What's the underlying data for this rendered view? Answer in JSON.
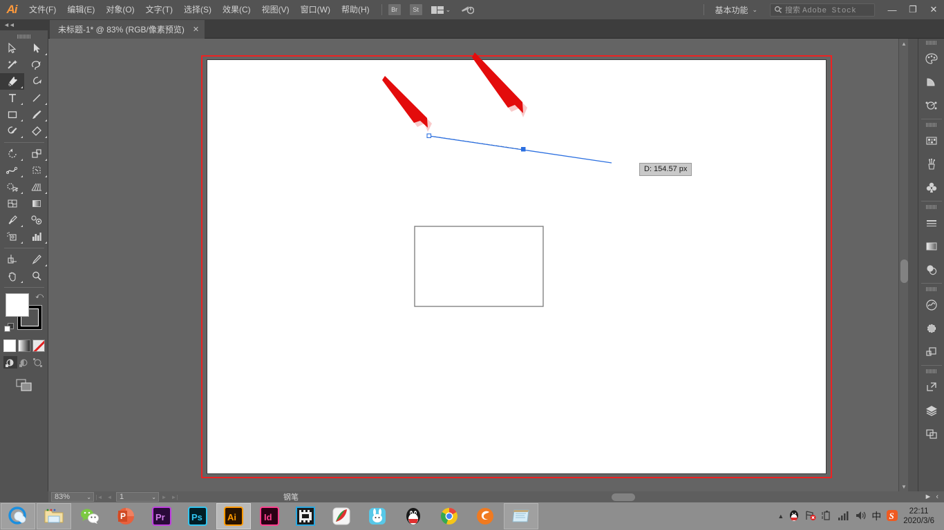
{
  "app": {
    "logo": "Ai",
    "name": "Adobe Illustrator"
  },
  "menubar": {
    "items": [
      {
        "label": "文件(F)",
        "name": "menu-file"
      },
      {
        "label": "编辑(E)",
        "name": "menu-edit"
      },
      {
        "label": "对象(O)",
        "name": "menu-object"
      },
      {
        "label": "文字(T)",
        "name": "menu-type"
      },
      {
        "label": "选择(S)",
        "name": "menu-select"
      },
      {
        "label": "效果(C)",
        "name": "menu-effect"
      },
      {
        "label": "视图(V)",
        "name": "menu-view"
      },
      {
        "label": "窗口(W)",
        "name": "menu-window"
      },
      {
        "label": "帮助(H)",
        "name": "menu-help"
      }
    ],
    "bridge_button": "Br",
    "stock_button": "St",
    "arrange_caret": "⌄",
    "workspace": "基本功能",
    "workspace_caret": "⌄",
    "search_placeholder": "搜索",
    "search_brand": "Adobe Stock",
    "minimize": "—",
    "restore": "❐",
    "close": "✕"
  },
  "tab": {
    "title": "未标题-1* @ 83% (RGB/像素预览)",
    "close": "✕"
  },
  "toolbar": {
    "collapse": "◄◄",
    "tools": [
      {
        "name": "selection-tool",
        "icon": "cursor-arrow",
        "active": false,
        "corner": false
      },
      {
        "name": "direct-selection-tool",
        "icon": "direct-select",
        "active": false,
        "corner": true
      },
      {
        "name": "magic-wand-tool",
        "icon": "magic-wand",
        "active": false,
        "corner": false
      },
      {
        "name": "lasso-tool",
        "icon": "lasso",
        "active": false,
        "corner": false
      },
      {
        "name": "pen-tool",
        "icon": "pen",
        "active": true,
        "corner": true
      },
      {
        "name": "curvature-tool",
        "icon": "curvature",
        "active": false,
        "corner": false
      },
      {
        "name": "type-tool",
        "icon": "type",
        "active": false,
        "corner": true
      },
      {
        "name": "line-segment-tool",
        "icon": "line-segment",
        "active": false,
        "corner": true
      },
      {
        "name": "rectangle-tool",
        "icon": "rectangle",
        "active": false,
        "corner": true
      },
      {
        "name": "paintbrush-tool",
        "icon": "paintbrush",
        "active": false,
        "corner": true
      },
      {
        "name": "shaper-tool",
        "icon": "shaper-pencil",
        "active": false,
        "corner": true
      },
      {
        "name": "eraser-tool",
        "icon": "eraser",
        "active": false,
        "corner": true
      },
      {
        "name": "rotate-tool",
        "icon": "rotate",
        "active": false,
        "corner": true
      },
      {
        "name": "scale-tool",
        "icon": "scale",
        "active": false,
        "corner": true
      },
      {
        "name": "width-tool",
        "icon": "width-warp",
        "active": false,
        "corner": true
      },
      {
        "name": "free-transform-tool",
        "icon": "free-transform",
        "active": false,
        "corner": true
      },
      {
        "name": "shape-builder-tool",
        "icon": "shape-builder",
        "active": false,
        "corner": true
      },
      {
        "name": "perspective-grid-tool",
        "icon": "perspective-grid",
        "active": false,
        "corner": true
      },
      {
        "name": "mesh-tool",
        "icon": "mesh",
        "active": false,
        "corner": false
      },
      {
        "name": "gradient-tool",
        "icon": "gradient",
        "active": false,
        "corner": false
      },
      {
        "name": "eyedropper-tool",
        "icon": "eyedropper",
        "active": false,
        "corner": true
      },
      {
        "name": "blend-tool",
        "icon": "blend",
        "active": false,
        "corner": false
      },
      {
        "name": "symbol-sprayer-tool",
        "icon": "symbol-sprayer",
        "active": false,
        "corner": true
      },
      {
        "name": "column-graph-tool",
        "icon": "column-graph",
        "active": false,
        "corner": true
      },
      {
        "name": "artboard-tool",
        "icon": "artboard",
        "active": false,
        "corner": false
      },
      {
        "name": "slice-tool",
        "icon": "slice-knife",
        "active": false,
        "corner": true
      },
      {
        "name": "hand-tool",
        "icon": "hand",
        "active": false,
        "corner": true
      },
      {
        "name": "zoom-tool",
        "icon": "magnifier",
        "active": false,
        "corner": false
      }
    ],
    "fill_color": "#ffffff",
    "stroke_color": "#000000",
    "swap_icon": "⤺",
    "paint_modes": [
      {
        "name": "color-mode-solid",
        "selected": true
      },
      {
        "name": "color-mode-gradient",
        "selected": false
      },
      {
        "name": "color-mode-none",
        "selected": false
      }
    ],
    "draw_modes": [
      {
        "name": "draw-normal-mode",
        "selected": true
      },
      {
        "name": "draw-behind-mode",
        "selected": false
      },
      {
        "name": "draw-inside-mode",
        "selected": false
      }
    ],
    "screen_mode": "change-screen-mode"
  },
  "canvas": {
    "artboard_border_color": "#ee2222",
    "path_color": "#2b6fe0",
    "annotation_color": "#e30c0c",
    "dimension_label": "D: 154.57 px",
    "anchors": [
      {
        "name": "path-anchor-start",
        "filled": false
      },
      {
        "name": "path-anchor-mid",
        "filled": true
      }
    ],
    "shapes": [
      {
        "name": "rectangle-shape",
        "stroke": "#7a7a7a"
      }
    ]
  },
  "statusbar": {
    "zoom": "83%",
    "zoom_caret": "⌄",
    "first_page": "|◄",
    "prev_page": "◄",
    "page": "1",
    "page_caret": "⌄",
    "next_page": "►",
    "last_page": "►|",
    "tool_name": "钢笔",
    "expand": "►",
    "collapse": "‹"
  },
  "rightpanel": {
    "icons": [
      {
        "name": "color-panel-icon",
        "glyph": "palette"
      },
      {
        "name": "color-guide-panel-icon",
        "glyph": "wedge"
      },
      {
        "name": "pathfinder-panel-icon",
        "glyph": "path-node"
      },
      {
        "name": "swatches-panel-icon",
        "glyph": "swatches"
      },
      {
        "name": "brushes-panel-icon",
        "glyph": "brushes"
      },
      {
        "name": "symbols-panel-icon",
        "glyph": "clover"
      },
      {
        "name": "stroke-panel-icon",
        "glyph": "lines"
      },
      {
        "name": "gradient-panel-icon",
        "glyph": "gradient-box"
      },
      {
        "name": "transparency-panel-icon",
        "glyph": "two-circles"
      },
      {
        "name": "cc-libraries-panel-icon",
        "glyph": "cc-cloud"
      },
      {
        "name": "appearance-panel-icon",
        "glyph": "dashed-circle"
      },
      {
        "name": "align-panel-icon",
        "glyph": "two-squares"
      },
      {
        "name": "export-panel-icon",
        "glyph": "export-arrow"
      },
      {
        "name": "layers-panel-icon",
        "glyph": "layers-stack"
      },
      {
        "name": "artboards-panel-icon",
        "glyph": "artboards"
      }
    ]
  },
  "taskbar": {
    "items": [
      {
        "name": "taskbar-qq-browser",
        "label": "QQ浏览器",
        "state": "framed"
      },
      {
        "name": "taskbar-file-explorer",
        "label": "文件资源管理器",
        "state": "framed"
      },
      {
        "name": "taskbar-wechat",
        "label": "微信",
        "state": "plain"
      },
      {
        "name": "taskbar-powerpoint",
        "label": "PowerPoint",
        "state": "plain"
      },
      {
        "name": "taskbar-premiere",
        "label": "Pr",
        "state": "plain"
      },
      {
        "name": "taskbar-photoshop",
        "label": "Ps",
        "state": "plain"
      },
      {
        "name": "taskbar-illustrator",
        "label": "Ai",
        "state": "active"
      },
      {
        "name": "taskbar-indesign",
        "label": "Id",
        "state": "plain"
      },
      {
        "name": "taskbar-video-player",
        "label": "影音",
        "state": "plain"
      },
      {
        "name": "taskbar-pdf-reader",
        "label": "PDF",
        "state": "plain"
      },
      {
        "name": "taskbar-rabbit-app",
        "label": "兔小贝",
        "state": "plain"
      },
      {
        "name": "taskbar-qq",
        "label": "QQ",
        "state": "plain"
      },
      {
        "name": "taskbar-chrome",
        "label": "Chrome",
        "state": "plain"
      },
      {
        "name": "taskbar-firefox",
        "label": "浏览器",
        "state": "plain"
      },
      {
        "name": "taskbar-notepad",
        "label": "记事本",
        "state": "framed"
      }
    ],
    "tray": {
      "expand": "▲",
      "icons": [
        {
          "name": "tray-qq-icon",
          "glyph": "penguin"
        },
        {
          "name": "tray-network-icon",
          "glyph": "flag-error"
        },
        {
          "name": "tray-battery-icon",
          "glyph": "battery"
        },
        {
          "name": "tray-signal-icon",
          "glyph": "signal"
        },
        {
          "name": "tray-volume-icon",
          "glyph": "speaker"
        },
        {
          "name": "tray-ime-icon",
          "glyph": "中"
        },
        {
          "name": "tray-sogou-icon",
          "glyph": "S"
        }
      ],
      "time": "22:11",
      "date": "2020/3/6"
    }
  }
}
